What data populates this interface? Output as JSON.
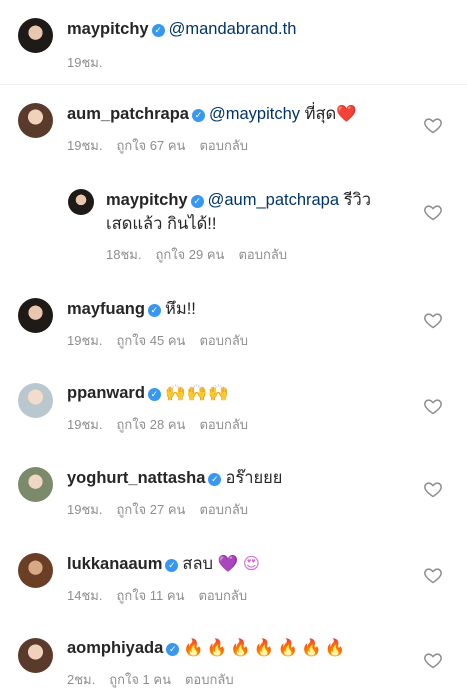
{
  "caption": {
    "username": "maypitchy",
    "mention": "@mandabrand.th",
    "time": "19ชม."
  },
  "comments": [
    {
      "username": "aum_patchrapa",
      "mention": "@maypitchy",
      "text": "ที่สุด",
      "emoji": "❤️",
      "time": "19ชม.",
      "likes": "ถูกใจ 67 คน",
      "reply": "ตอบกลับ"
    },
    {
      "username": "maypitchy",
      "mention": "@aum_patchrapa",
      "text": "รีวิว",
      "text2": "เสดแล้ว กินได้!!",
      "time": "18ชม.",
      "likes": "ถูกใจ 29 คน",
      "reply": "ตอบกลับ"
    },
    {
      "username": "mayfuang",
      "mention": "",
      "text": "หึม!!",
      "time": "19ชม.",
      "likes": "ถูกใจ 45 คน",
      "reply": "ตอบกลับ"
    },
    {
      "username": "ppanward",
      "mention": "",
      "text": "",
      "emoji": "🙌🙌🙌",
      "time": "19ชม.",
      "likes": "ถูกใจ 28 คน",
      "reply": "ตอบกลับ"
    },
    {
      "username": "yoghurt_nattasha",
      "mention": "",
      "text": "อร๊ายยย",
      "time": "19ชม.",
      "likes": "ถูกใจ 27 คน",
      "reply": "ตอบกลับ"
    },
    {
      "username": "lukkanaaum",
      "mention": "",
      "text": "สลบ",
      "emoji": "💜 😍",
      "time": "14ชม.",
      "likes": "ถูกใจ 11 คน",
      "reply": "ตอบกลับ"
    },
    {
      "username": "aomphiyada",
      "mention": "",
      "text": "",
      "emoji": "🔥🔥🔥🔥🔥🔥🔥",
      "time": "2ชม.",
      "likes": "ถูกใจ 1 คน",
      "reply": "ตอบกลับ"
    }
  ],
  "icons": {
    "verified": "✓",
    "like": "heart-outline-icon"
  }
}
